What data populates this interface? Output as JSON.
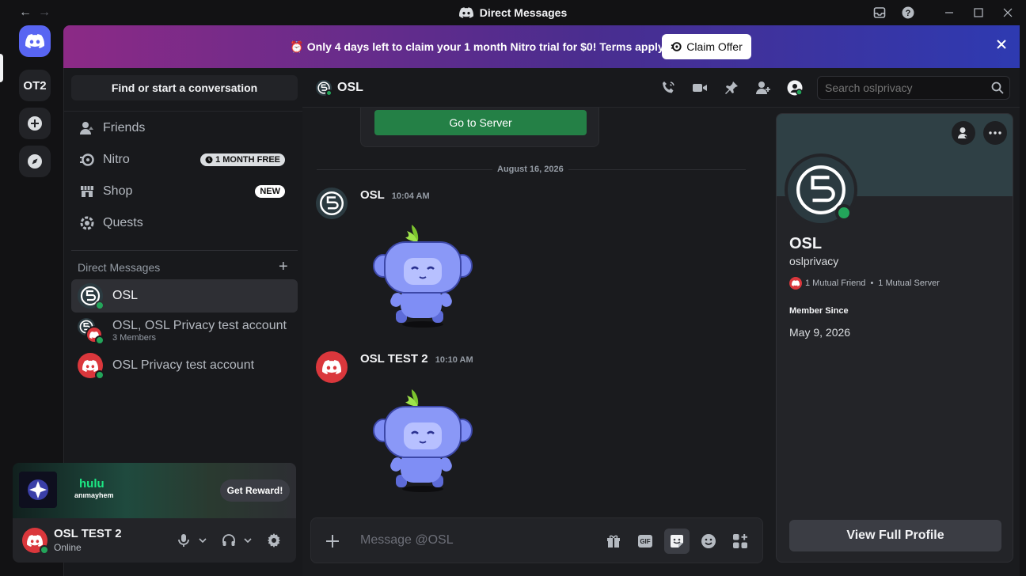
{
  "window": {
    "title": "Direct Messages",
    "back_glyph": "←",
    "forward_glyph": "→"
  },
  "servers": {
    "items": [
      {
        "label": "OT2"
      }
    ]
  },
  "banner": {
    "emoji": "⏰",
    "text": "Only 4 days left to claim your 1 month Nitro trial for $0! Terms apply.",
    "claim_label": "Claim Offer",
    "colors": {
      "start": "#8c2a86",
      "end": "#2e3ab1"
    }
  },
  "sidebar": {
    "find_label": "Find or start a conversation",
    "nav": [
      {
        "label": "Friends",
        "icon": "friends-icon"
      },
      {
        "label": "Nitro",
        "icon": "nitro-icon",
        "badge": "1 MONTH FREE"
      },
      {
        "label": "Shop",
        "icon": "shop-icon",
        "badge": "NEW"
      },
      {
        "label": "Quests",
        "icon": "quests-icon"
      }
    ],
    "dm_header": "Direct Messages",
    "dms": [
      {
        "name": "OSL",
        "sub": ""
      },
      {
        "name": "OSL, OSL Privacy test account",
        "sub": "3 Members"
      },
      {
        "name": "OSL Privacy test account",
        "sub": ""
      }
    ]
  },
  "reward": {
    "brand": "hulu",
    "brand_sub": "anımayhem",
    "button_label": "Get Reward!"
  },
  "user": {
    "name": "OSL TEST 2",
    "status": "Online"
  },
  "chat": {
    "channel_name": "OSL",
    "search_placeholder": "Search oslprivacy",
    "embed_button": "Go to Server",
    "date_divider": "August 16, 2026",
    "messages": [
      {
        "author": "OSL",
        "time": "10:04 AM",
        "sticker": "wumpus-sticker"
      },
      {
        "author": "OSL TEST 2",
        "time": "10:10 AM",
        "sticker": "wumpus-sticker"
      }
    ],
    "composer_placeholder": "Message @OSL",
    "gif_label": "GIF"
  },
  "profile": {
    "name": "OSL",
    "username": "oslprivacy",
    "mutual_friends": "1 Mutual Friend",
    "separator": "•",
    "mutual_servers": "1 Mutual Server",
    "member_since_label": "Member Since",
    "member_since": "May 9, 2026",
    "view_full_label": "View Full Profile"
  },
  "colors": {
    "accent": "#5865f2",
    "online": "#23a55a",
    "go_button": "#248046",
    "avatar_red": "#da373c"
  }
}
